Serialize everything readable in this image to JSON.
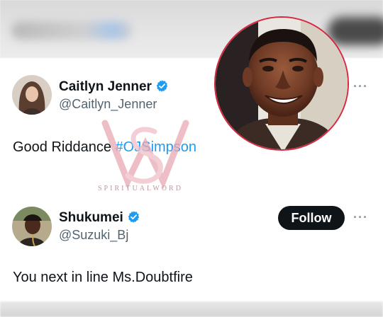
{
  "tweet1": {
    "name": "Caitlyn Jenner",
    "handle": "@Caitlyn_Jenner",
    "text_plain": "Good Riddance ",
    "hashtag": "#OJSimpson",
    "more": "···"
  },
  "tweet2": {
    "name": "Shukumei",
    "handle": "@Suzuki_Bj",
    "follow_label": "Follow",
    "text": "You next in line Ms.Doubtfire",
    "more": "···"
  },
  "watermark": {
    "text": "SPIRITUALWORD"
  },
  "colors": {
    "verified": "#1d9bf0",
    "hashtag": "#1d9bf0",
    "follow_bg": "#0f1419",
    "photo_border": "#d7263d",
    "watermark": "#e8a9b4"
  },
  "icons": [
    "verified-badge-icon",
    "more-icon"
  ]
}
